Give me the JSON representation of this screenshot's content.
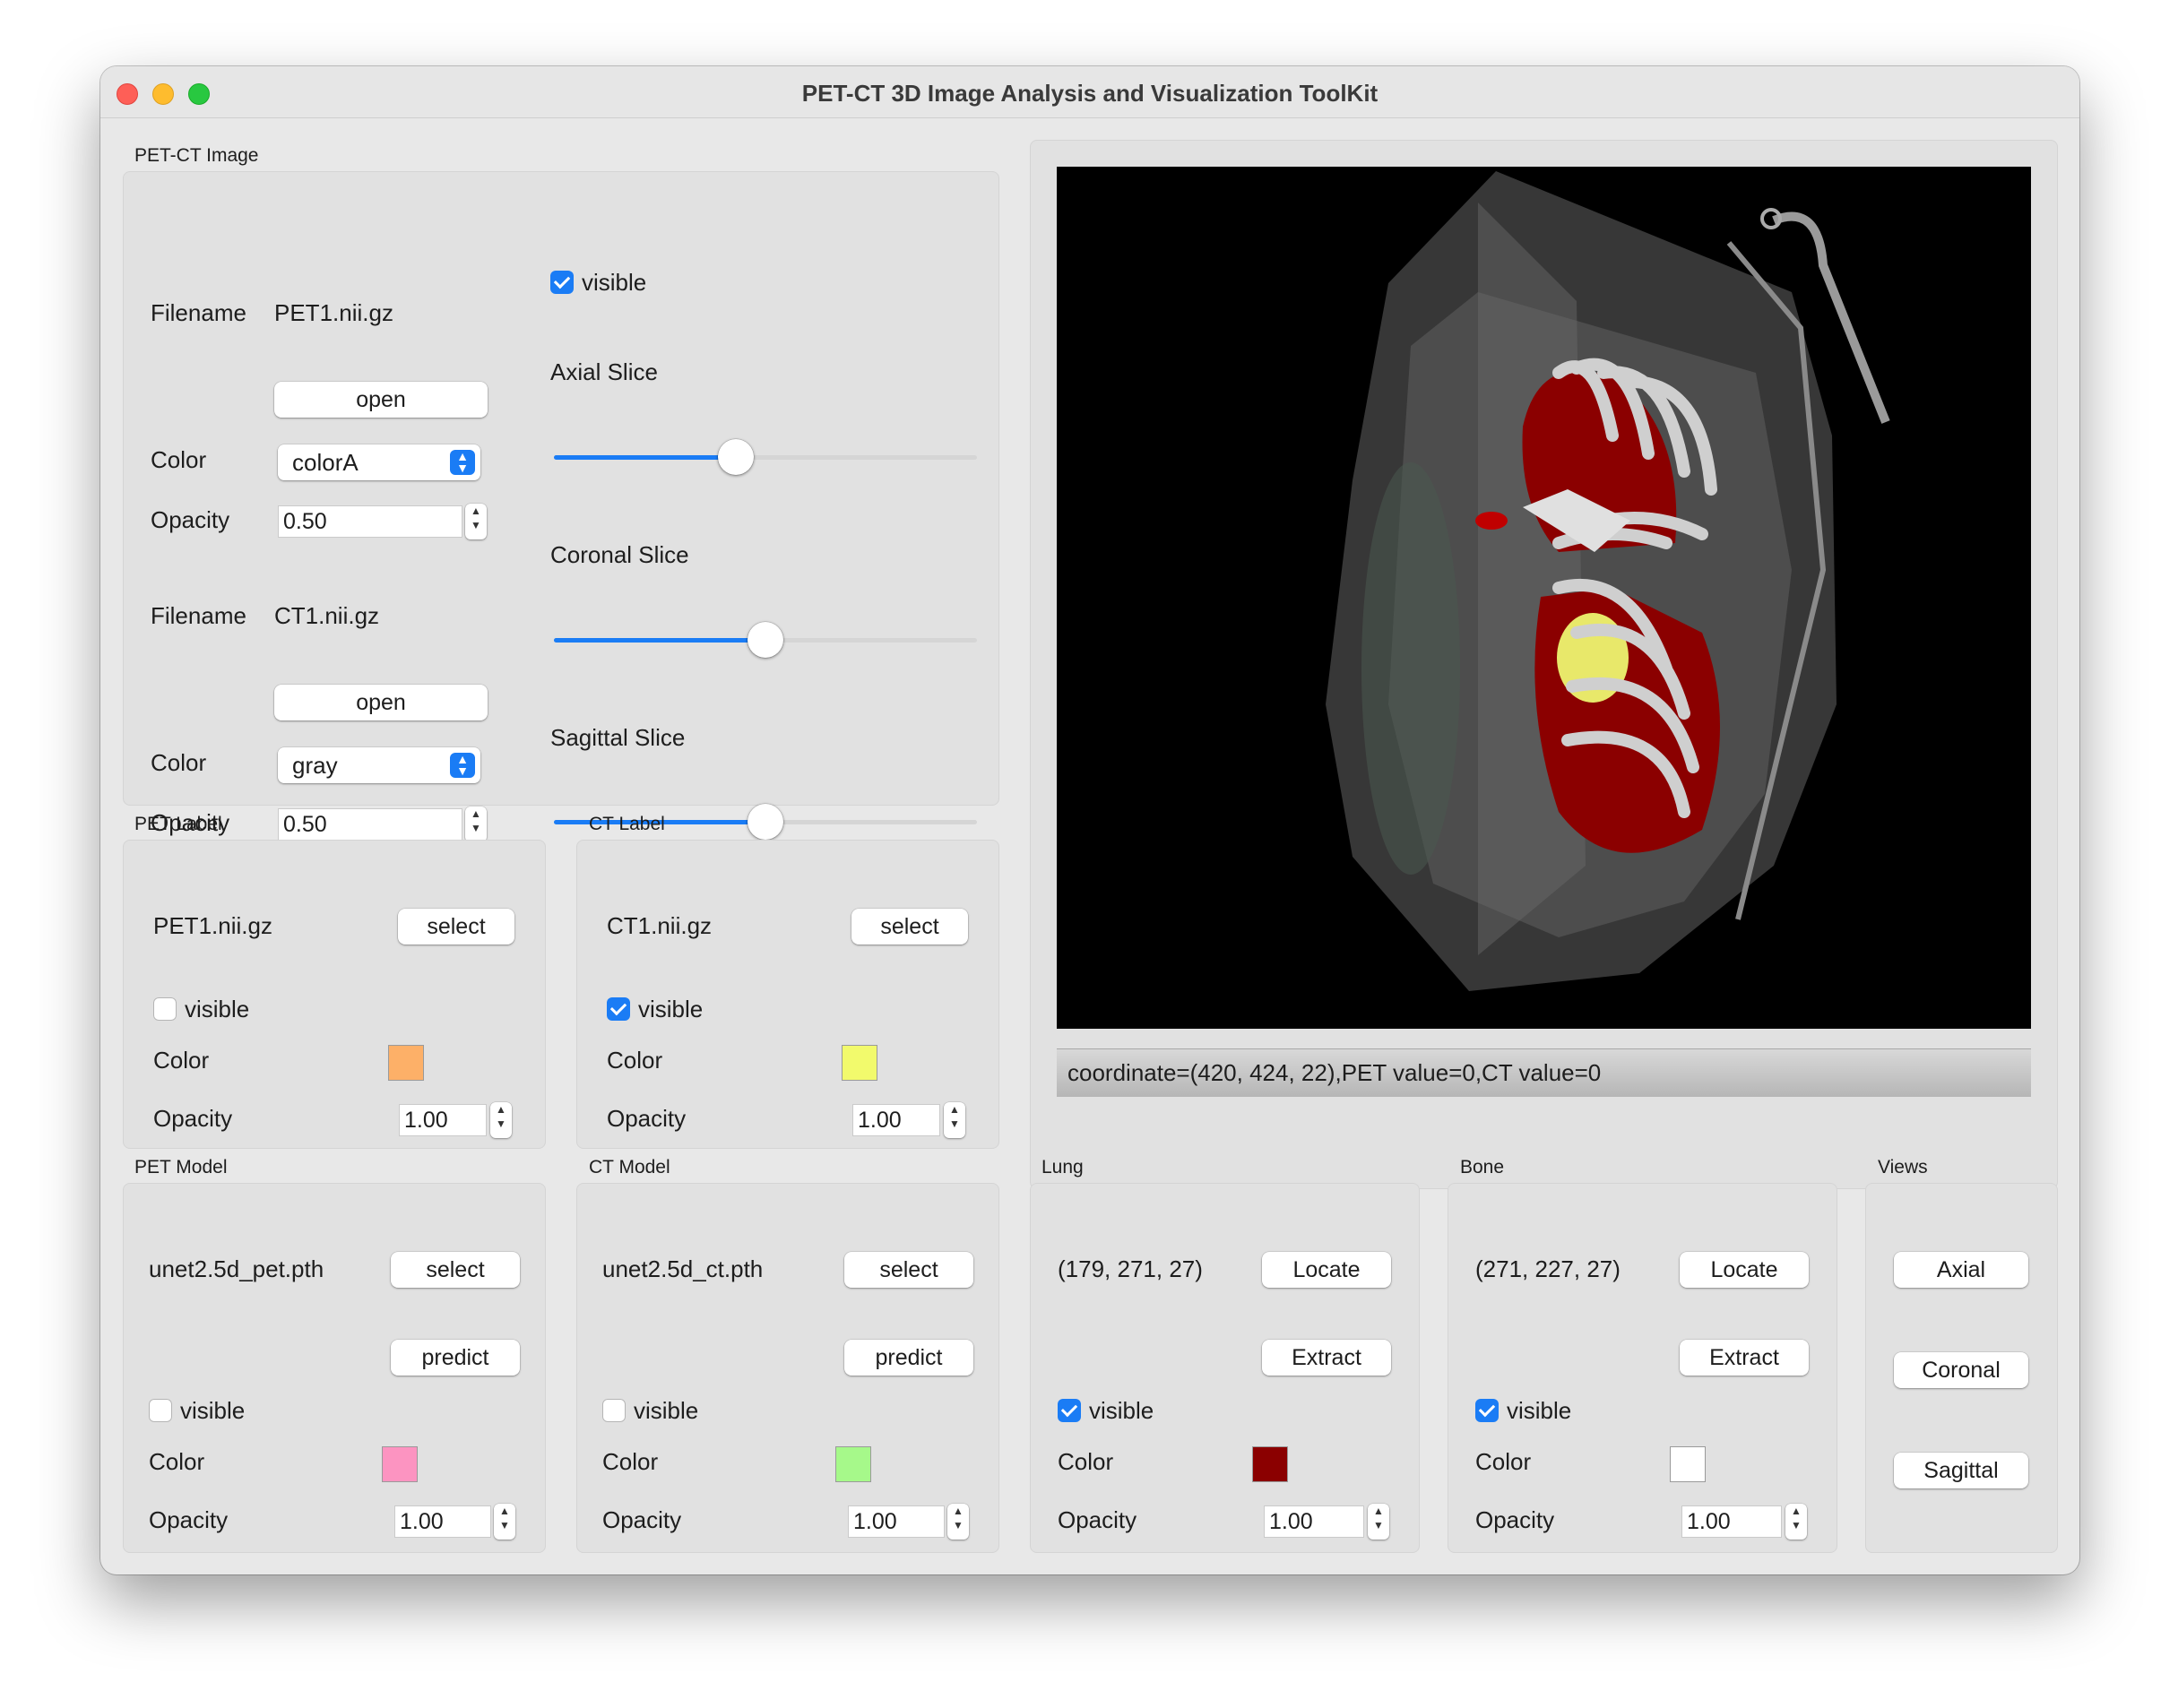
{
  "window": {
    "title": "PET-CT 3D Image Analysis and Visualization ToolKit"
  },
  "petct": {
    "group_title": "PET-CT Image",
    "filename_label": "Filename",
    "pet_filename": "PET1.nii.gz",
    "ct_filename": "CT1.nii.gz",
    "open_label": "open",
    "color_label": "Color",
    "opacity_label": "Opacity",
    "pet_color": "colorA",
    "ct_color": "gray",
    "pet_opacity": "0.50",
    "ct_opacity": "0.50",
    "visible_label": "visible",
    "visible_checked": true,
    "axial_label": "Axial Slice",
    "coronal_label": "Coronal Slice",
    "sagittal_label": "Sagittal Slice",
    "axial_value": 0.43,
    "coronal_value": 0.5,
    "sagittal_value": 0.5
  },
  "pet_label": {
    "group_title": "PET Label",
    "filename": "PET1.nii.gz",
    "select_label": "select",
    "visible_label": "visible",
    "visible_checked": false,
    "color_label": "Color",
    "color": "#fdb068",
    "opacity_label": "Opacity",
    "opacity": "1.00"
  },
  "ct_label": {
    "group_title": "CT Label",
    "filename": "CT1.nii.gz",
    "select_label": "select",
    "visible_label": "visible",
    "visible_checked": true,
    "color_label": "Color",
    "color": "#f2fa6c",
    "opacity_label": "Opacity",
    "opacity": "1.00"
  },
  "pet_model": {
    "group_title": "PET Model",
    "filename": "unet2.5d_pet.pth",
    "select_label": "select",
    "predict_label": "predict",
    "visible_label": "visible",
    "visible_checked": false,
    "color_label": "Color",
    "color": "#fc94c1",
    "opacity_label": "Opacity",
    "opacity": "1.00"
  },
  "ct_model": {
    "group_title": "CT Model",
    "filename": "unet2.5d_ct.pth",
    "select_label": "select",
    "predict_label": "predict",
    "visible_label": "visible",
    "visible_checked": false,
    "color_label": "Color",
    "color": "#a6f98a",
    "opacity_label": "Opacity",
    "opacity": "1.00"
  },
  "lung": {
    "group_title": "Lung",
    "coord": "(179, 271, 27)",
    "locate_label": "Locate",
    "extract_label": "Extract",
    "visible_label": "visible",
    "visible_checked": true,
    "color_label": "Color",
    "color": "#8b0000",
    "opacity_label": "Opacity",
    "opacity": "1.00"
  },
  "bone": {
    "group_title": "Bone",
    "coord": "(271, 227, 27)",
    "locate_label": "Locate",
    "extract_label": "Extract",
    "visible_label": "visible",
    "visible_checked": true,
    "color_label": "Color",
    "color": "#ffffff",
    "opacity_label": "Opacity",
    "opacity": "1.00"
  },
  "views": {
    "group_title": "Views",
    "axial_label": "Axial",
    "coronal_label": "Coronal",
    "sagittal_label": "Sagittal"
  },
  "viewer": {
    "status": "coordinate=(420, 424, 22),PET value=0,CT value=0"
  }
}
